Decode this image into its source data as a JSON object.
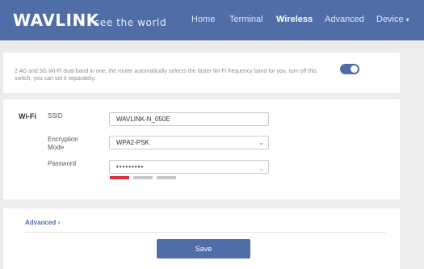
{
  "header": {
    "logo": "WAVLINK",
    "tagline": "see the world",
    "nav": [
      {
        "label": "Home"
      },
      {
        "label": "Terminal"
      },
      {
        "label": "Wireless"
      },
      {
        "label": "Advanced"
      },
      {
        "label": "Device"
      }
    ],
    "active_nav": "Wireless",
    "brand_color": "#4f6ea8"
  },
  "dual_band": {
    "description": "2.4G and 5G Wi-Fi dual-band in one, the router automatically selects the faster Wi-Fi frequency band for you, turn off this switch, you can set it separately.",
    "enabled": true
  },
  "wifi": {
    "section_label": "Wi-Fi",
    "ssid_label": "SSID",
    "ssid_value": "WAVLINK-N_050E",
    "encryption_label": "Encryption Mode",
    "encryption_value": "WPA2-PSK",
    "password_label": "Password",
    "password_value": "•••••••••",
    "password_strength": 1,
    "password_strength_max": 3
  },
  "footer": {
    "advanced_label": "Advanced",
    "save_label": "Save"
  }
}
